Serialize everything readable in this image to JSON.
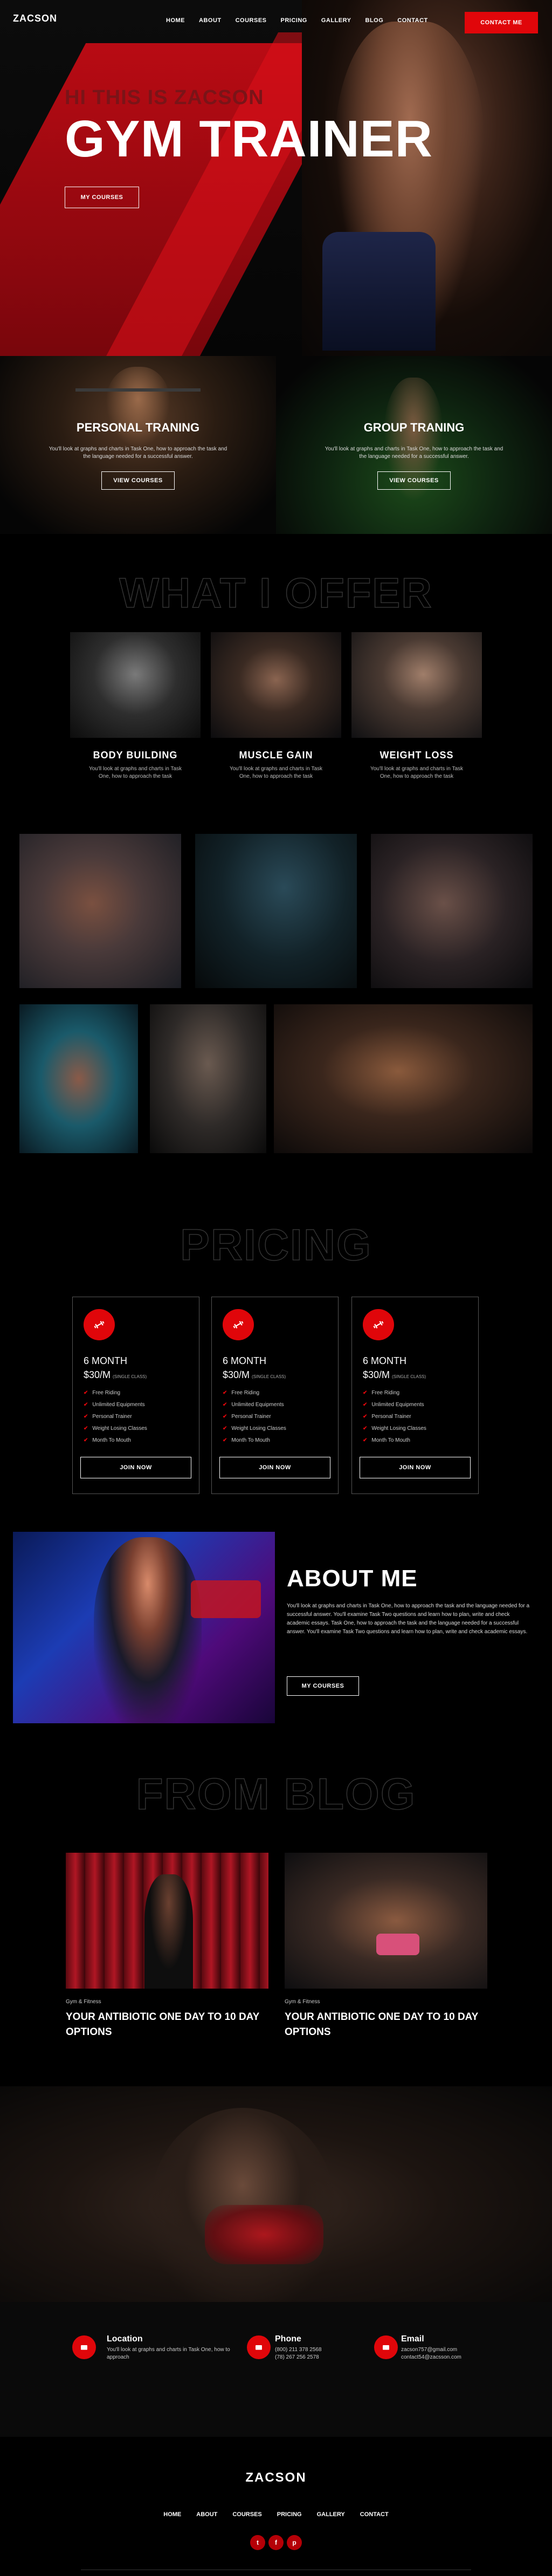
{
  "header": {
    "logo": "ZACSON",
    "nav": [
      "HOME",
      "ABOUT",
      "COURSES",
      "PRICING",
      "GALLERY",
      "BLOG",
      "CONTACT"
    ],
    "cta": "CONTACT ME"
  },
  "hero": {
    "subtitle": "HI THIS IS ZACSON",
    "title": "GYM TRAINER",
    "button": "MY COURSES"
  },
  "training": [
    {
      "title": "PERSONAL TRANING",
      "text": "You'll look at graphs and charts in Task One, how to approach the task and the language needed for a successful answer.",
      "button": "VIEW COURSES"
    },
    {
      "title": "GROUP TRANING",
      "text": "You'll look at graphs and charts in Task One, how to approach the task and the language needed for a successful answer.",
      "button": "VIEW COURSES"
    }
  ],
  "offer": {
    "heading": "WHAT I OFFER",
    "items": [
      {
        "title": "BODY BUILDING",
        "text": "You'll look at graphs and charts in Task One, how to approach the task"
      },
      {
        "title": "MUSCLE GAIN",
        "text": "You'll look at graphs and charts in Task One, how to approach the task"
      },
      {
        "title": "WEIGHT LOSS",
        "text": "You'll look at graphs and charts in Task One, how to approach the task"
      }
    ]
  },
  "pricing": {
    "heading": "PRICING",
    "plans": [
      {
        "duration": "6 MONTH",
        "price": "$30/M",
        "note": "(SINGLE CLASS)",
        "features": [
          "Free Riding",
          "Unlimited Equipments",
          "Personal Trainer",
          "Weight Losing Classes",
          "Month To Mouth"
        ],
        "button": "JOIN NOW"
      },
      {
        "duration": "6 MONTH",
        "price": "$30/M",
        "note": "(SINGLE CLASS)",
        "features": [
          "Free Riding",
          "Unlimited Equipments",
          "Personal Trainer",
          "Weight Losing Classes",
          "Month To Mouth"
        ],
        "button": "JOIN NOW"
      },
      {
        "duration": "6 MONTH",
        "price": "$30/M",
        "note": "(SINGLE CLASS)",
        "features": [
          "Free Riding",
          "Unlimited Equipments",
          "Personal Trainer",
          "Weight Losing Classes",
          "Month To Mouth"
        ],
        "button": "JOIN NOW"
      }
    ]
  },
  "about": {
    "title": "ABOUT ME",
    "text": "You'll look at graphs and charts in Task One, how to approach the task and the language needed for a successful answer. You'll examine Task Two questions and learn how to plan, write and check academic essays. Task One, how to approach the task and the language needed for a successful answer. You'll examine Task Two questions and learn how to plan, write and check academic essays.",
    "button": "MY COURSES"
  },
  "blog": {
    "heading": "FROM BLOG",
    "posts": [
      {
        "category": "Gym & Fitness",
        "title": "YOUR ANTIBIOTIC ONE DAY TO 10 DAY OPTIONS"
      },
      {
        "category": "Gym & Fitness",
        "title": "YOUR ANTIBIOTIC ONE DAY TO 10 DAY OPTIONS"
      }
    ]
  },
  "contact": [
    {
      "title": "Location",
      "lines": [
        "You'll look at graphs and charts in Task One, how to",
        "approach"
      ]
    },
    {
      "title": "Phone",
      "lines": [
        "(800) 211 378 2568",
        "(78) 267 256 2578"
      ]
    },
    {
      "title": "Email",
      "lines": [
        "zacson757@gmail.com",
        "contact54@zacsson.com"
      ]
    }
  ],
  "footer": {
    "logo": "ZACSON",
    "nav": [
      "HOME",
      "ABOUT",
      "COURSES",
      "PRICING",
      "GALLERY",
      "CONTACT"
    ],
    "social": [
      "t",
      "f",
      "p"
    ]
  },
  "colors": {
    "accent": "#e0060a",
    "background": "#000000"
  }
}
